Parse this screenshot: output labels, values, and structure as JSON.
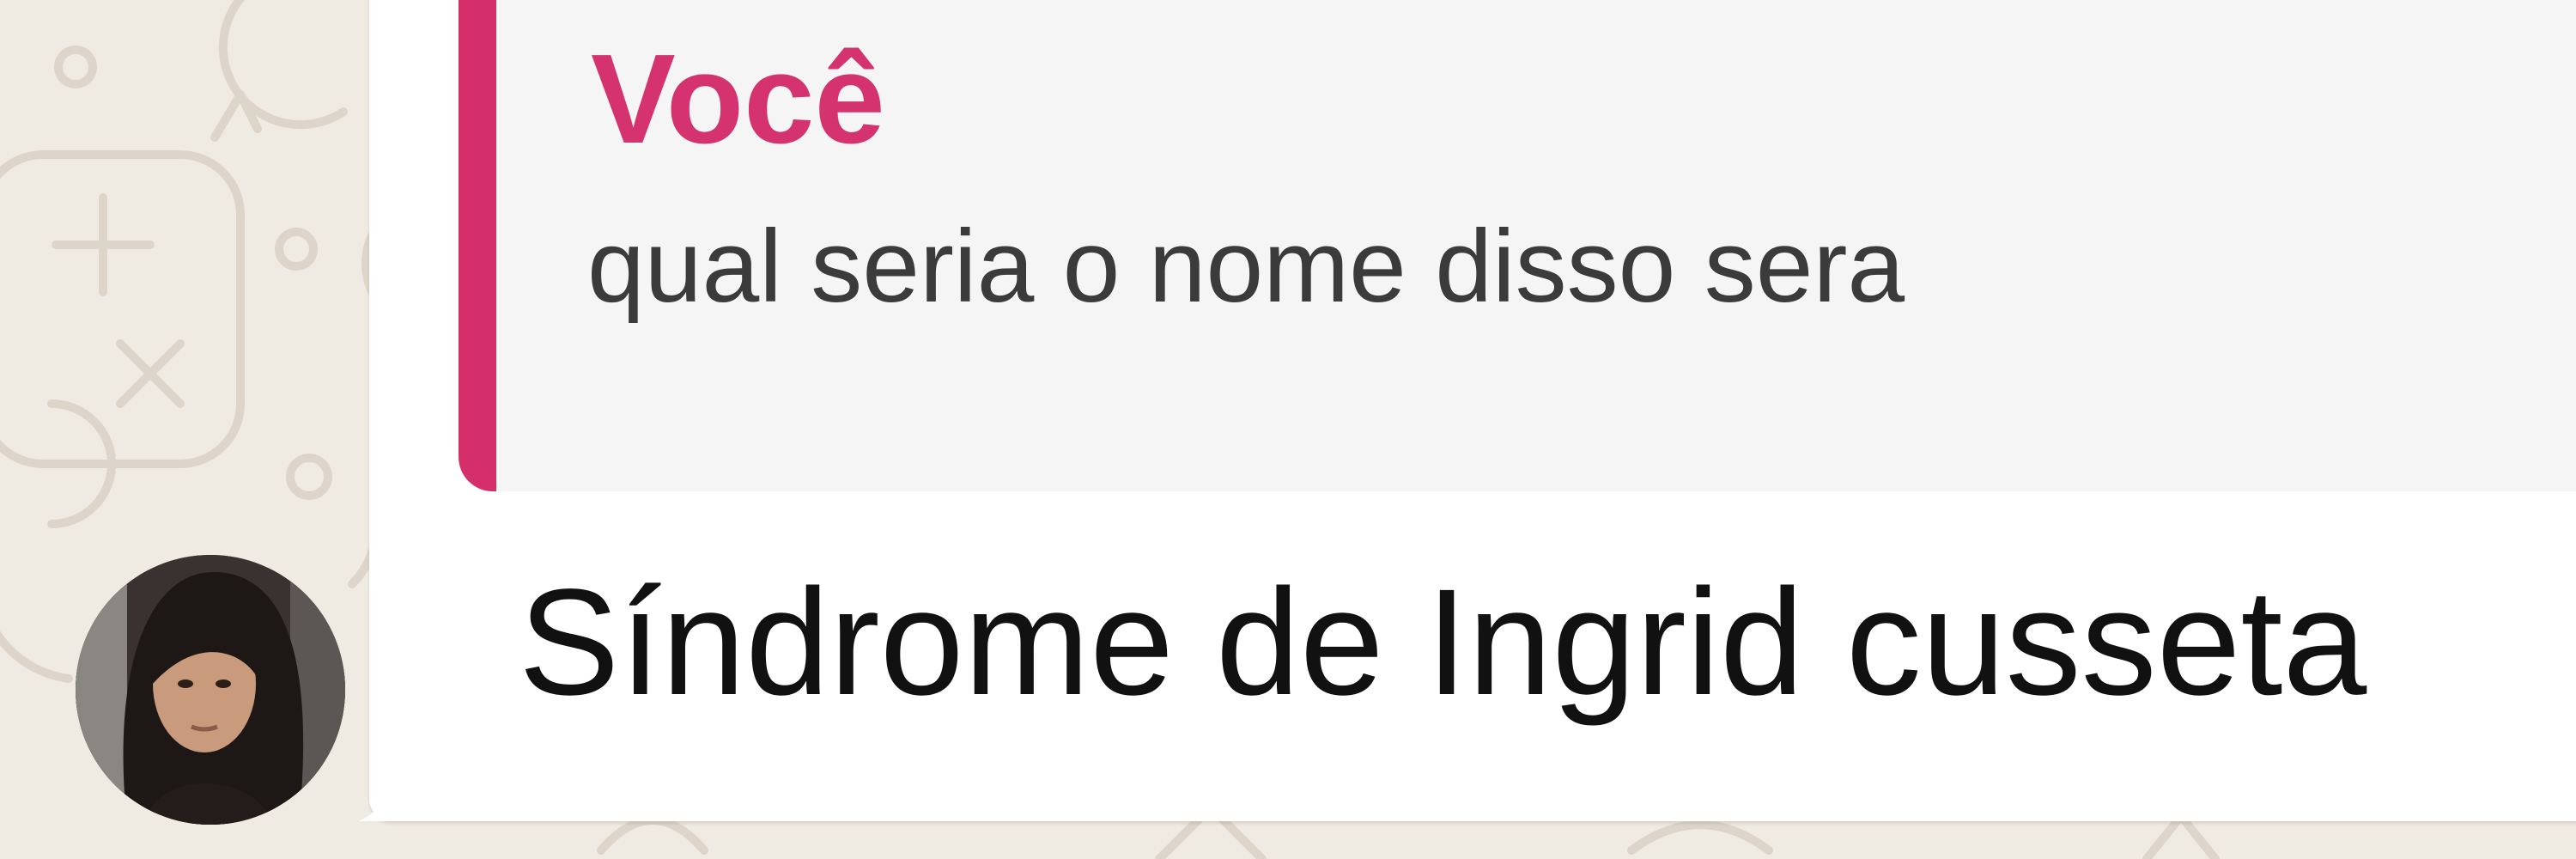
{
  "colors": {
    "chat_background": "#efeae2",
    "bubble": "#ffffff",
    "quote_background": "#f5f5f5",
    "quote_accent": "#d42e6b",
    "quote_author": "#d4336f",
    "message_text": "#111111"
  },
  "icons": [
    "chat-wallpaper-doodles",
    "contact-avatar"
  ],
  "message": {
    "quoted": {
      "author": "Você",
      "text": "qual seria o nome disso sera"
    },
    "text": "Síndrome de Ingrid cusseta"
  }
}
